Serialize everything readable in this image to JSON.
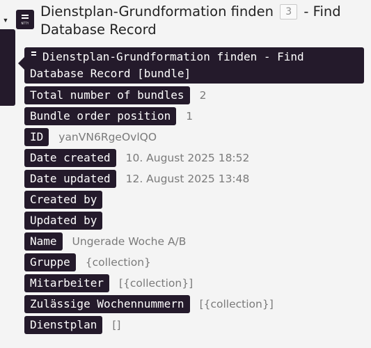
{
  "app_icon": {
    "name": "app-module-icon",
    "tiny_text": "NTTY"
  },
  "title": {
    "part1": "Dienstplan-Grundformation finden",
    "badge": "3",
    "part2": " - Find Database Record"
  },
  "bundle": {
    "icon": "app-module-icon",
    "label": "Dienstplan-Grundformation finden - Find Database Record [bundle]"
  },
  "fields": [
    {
      "key": "Total number of bundles",
      "value": "2"
    },
    {
      "key": "Bundle order position",
      "value": "1"
    },
    {
      "key": "ID",
      "value": "yanVN6RgeOvlQO"
    },
    {
      "key": "Date created",
      "value": "10. August 2025 18:52"
    },
    {
      "key": "Date updated",
      "value": "12. August 2025 13:48"
    },
    {
      "key": "Created by",
      "value": ""
    },
    {
      "key": "Updated by",
      "value": ""
    },
    {
      "key": "Name",
      "value": "Ungerade Woche A/B"
    },
    {
      "key": "Gruppe",
      "value": "{collection}"
    },
    {
      "key": "Mitarbeiter",
      "value": "[{collection}]"
    },
    {
      "key": "Zulässige Wochennummern",
      "value": "[{collection}]"
    },
    {
      "key": "Dienstplan",
      "value": "[]"
    }
  ],
  "colors": {
    "dark": "#241a2b",
    "background": "#f4f4f4",
    "value_text": "#7a7a7a"
  }
}
